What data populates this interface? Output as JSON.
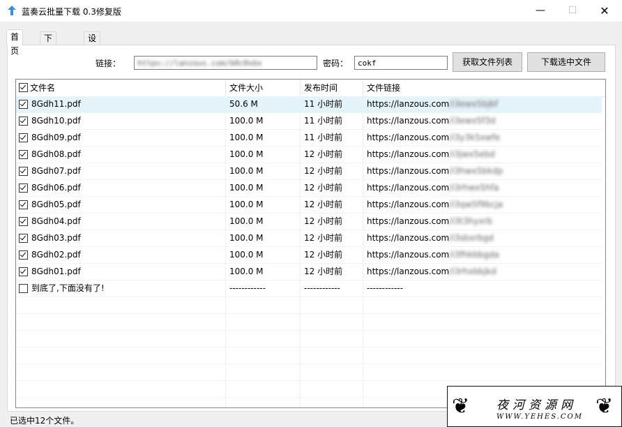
{
  "window": {
    "title": "蓝奏云批量下载 0.3修复版",
    "minimize_glyph": "—",
    "maximize_glyph": "☐",
    "close_glyph": "✕"
  },
  "tabs": [
    {
      "label": "首页",
      "active": true
    },
    {
      "label": "下载管理",
      "active": false
    },
    {
      "label": "设置&关于",
      "active": false
    }
  ],
  "form": {
    "link_label": "链接：",
    "link_value": "https://lanzous.com/b0c0xbx",
    "password_label": "密码：",
    "password_value": "cokf",
    "get_list_button": "获取文件列表",
    "download_button": "下载选中文件"
  },
  "table": {
    "columns": [
      "文件名",
      "文件大小",
      "发布时间",
      "文件链接"
    ],
    "rows": [
      {
        "name": "8Gdh11.pdf",
        "size": "50.6 M",
        "time": "11 小时前",
        "link": "https://lanzous.com",
        "link_hidden": "/i3ewx5bjbf",
        "checked": true,
        "selected": true
      },
      {
        "name": "8Gdh10.pdf",
        "size": "100.0 M",
        "time": "11 小时前",
        "link": "https://lanzous.com",
        "link_hidden": "/i3ewx5f3d",
        "checked": true,
        "selected": false
      },
      {
        "name": "8Gdh09.pdf",
        "size": "100.0 M",
        "time": "11 小时前",
        "link": "https://lanzous.com",
        "link_hidden": "/i3y3k5xwfe",
        "checked": true,
        "selected": false
      },
      {
        "name": "8Gdh08.pdf",
        "size": "100.0 M",
        "time": "12 小时前",
        "link": "https://lanzous.com",
        "link_hidden": "/i3jwx5ebd",
        "checked": true,
        "selected": false
      },
      {
        "name": "8Gdh07.pdf",
        "size": "100.0 M",
        "time": "12 小时前",
        "link": "https://lanzous.com",
        "link_hidden": "/i3hwx5bkdp",
        "checked": true,
        "selected": false
      },
      {
        "name": "8Gdh06.pdf",
        "size": "100.0 M",
        "time": "12 小时前",
        "link": "https://lanzous.com",
        "link_hidden": "/i3rhwx5hfa",
        "checked": true,
        "selected": false
      },
      {
        "name": "8Gdh05.pdf",
        "size": "100.0 M",
        "time": "12 小时前",
        "link": "https://lanzous.com",
        "link_hidden": "/i3qw5f9bcja",
        "checked": true,
        "selected": false
      },
      {
        "name": "8Gdh04.pdf",
        "size": "100.0 M",
        "time": "12 小时前",
        "link": "https://lanzous.com",
        "link_hidden": "/i3t3hyxrb",
        "checked": true,
        "selected": false
      },
      {
        "name": "8Gdh03.pdf",
        "size": "100.0 M",
        "time": "12 小时前",
        "link": "https://lanzous.com",
        "link_hidden": "/i3sbxrbgd",
        "checked": true,
        "selected": false
      },
      {
        "name": "8Gdh02.pdf",
        "size": "100.0 M",
        "time": "12 小时前",
        "link": "https://lanzous.com",
        "link_hidden": "/i3fhkbbgda",
        "checked": true,
        "selected": false
      },
      {
        "name": "8Gdh01.pdf",
        "size": "100.0 M",
        "time": "12 小时前",
        "link": "https://lanzous.com",
        "link_hidden": "/i3rhxbbjkd",
        "checked": true,
        "selected": false
      },
      {
        "name": "到底了,下面没有了!",
        "size": "------------",
        "time": "------------",
        "link": "------------",
        "link_hidden": "",
        "checked": false,
        "selected": false
      }
    ]
  },
  "status": {
    "text": "已选中12个文件。"
  },
  "watermark": {
    "title": "夜河资源网",
    "url": "WWW.YEHES.COM"
  }
}
